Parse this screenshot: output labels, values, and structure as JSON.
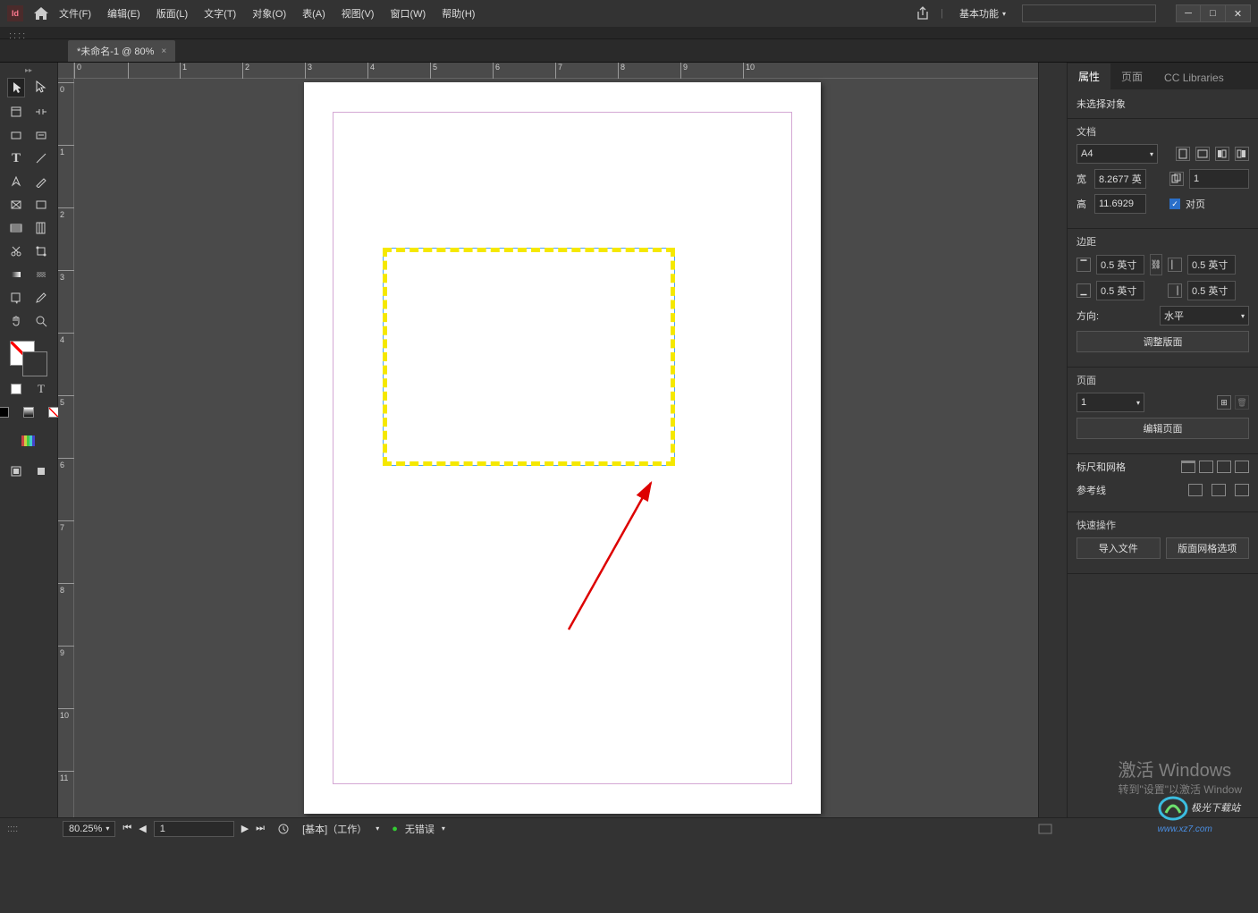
{
  "menu": {
    "file": "文件(F)",
    "edit": "编辑(E)",
    "layout": "版面(L)",
    "type": "文字(T)",
    "object": "对象(O)",
    "table": "表(A)",
    "view": "视图(V)",
    "window": "窗口(W)",
    "help": "帮助(H)"
  },
  "workspace": "基本功能",
  "tab": {
    "title": "*未命名-1 @ 80%",
    "close": "×"
  },
  "hruler": [
    "0",
    "1",
    "2",
    "3",
    "4",
    "5",
    "6",
    "7",
    "8",
    "9",
    "10"
  ],
  "vruler": [
    "0",
    "1",
    "2",
    "3",
    "4",
    "5",
    "6",
    "7",
    "8",
    "9",
    "10",
    "11"
  ],
  "panel": {
    "tabs": {
      "props": "属性",
      "pages": "页面",
      "cc": "CC Libraries"
    },
    "nosel": "未选择对象",
    "doc": "文档",
    "preset": "A4",
    "wlabel": "宽",
    "w": "8.2677 英",
    "hlabel": "高",
    "h": "11.6929",
    "pages_val": "1",
    "facing": "对页",
    "margins": "边距",
    "m_t": "0.5 英寸",
    "m_b": "0.5 英寸",
    "m_l": "0.5 英寸",
    "m_r": "0.5 英寸",
    "orient": "方向:",
    "orient_val": "水平",
    "adjust": "调整版面",
    "page_sec": "页面",
    "page_num": "1",
    "editpage": "编辑页面",
    "ruler_grid": "标尺和网格",
    "guides": "参考线",
    "quick": "快速操作",
    "import": "导入文件",
    "gridopt": "版面网格选项"
  },
  "status": {
    "zoom": "80.25%",
    "pg": "1",
    "master": "[基本]（工作）",
    "err": "无错误"
  },
  "watermark": {
    "t1": "激活 Windows",
    "t2": "转到\"设置\"以激活 Window"
  },
  "wmlogo": {
    "t": "极光下载站",
    "u": "www.xz7.com"
  }
}
